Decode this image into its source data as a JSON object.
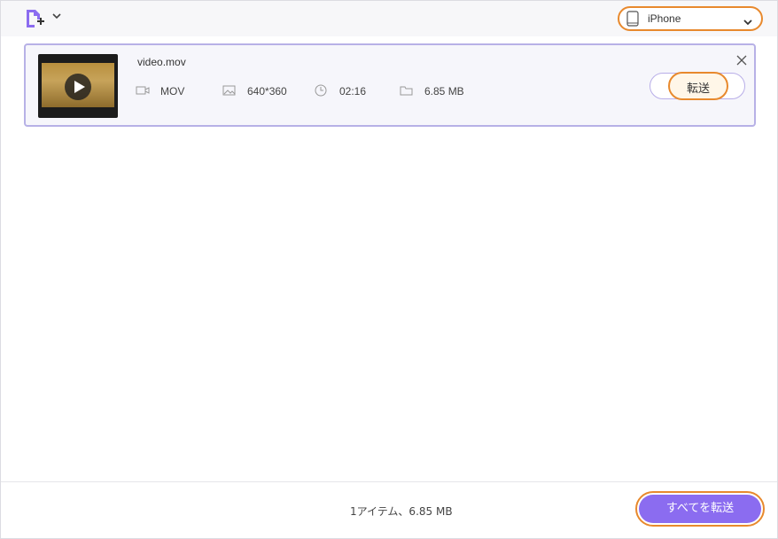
{
  "toolbar": {
    "add_file_icon": "add-file-icon",
    "device_select": {
      "selected": "iPhone",
      "icon": "phone-icon"
    }
  },
  "file_item": {
    "name": "video.mov",
    "format": "MOV",
    "resolution": "640*360",
    "duration": "02:16",
    "size": "6.85 MB",
    "transfer_label": "転送"
  },
  "footer": {
    "summary": "1アイテム、6.85 MB",
    "transfer_all_label": "すべてを転送"
  },
  "colors": {
    "accent": "#8b6cf0",
    "highlight": "#e8892d",
    "card_border": "#b7b1e6"
  }
}
